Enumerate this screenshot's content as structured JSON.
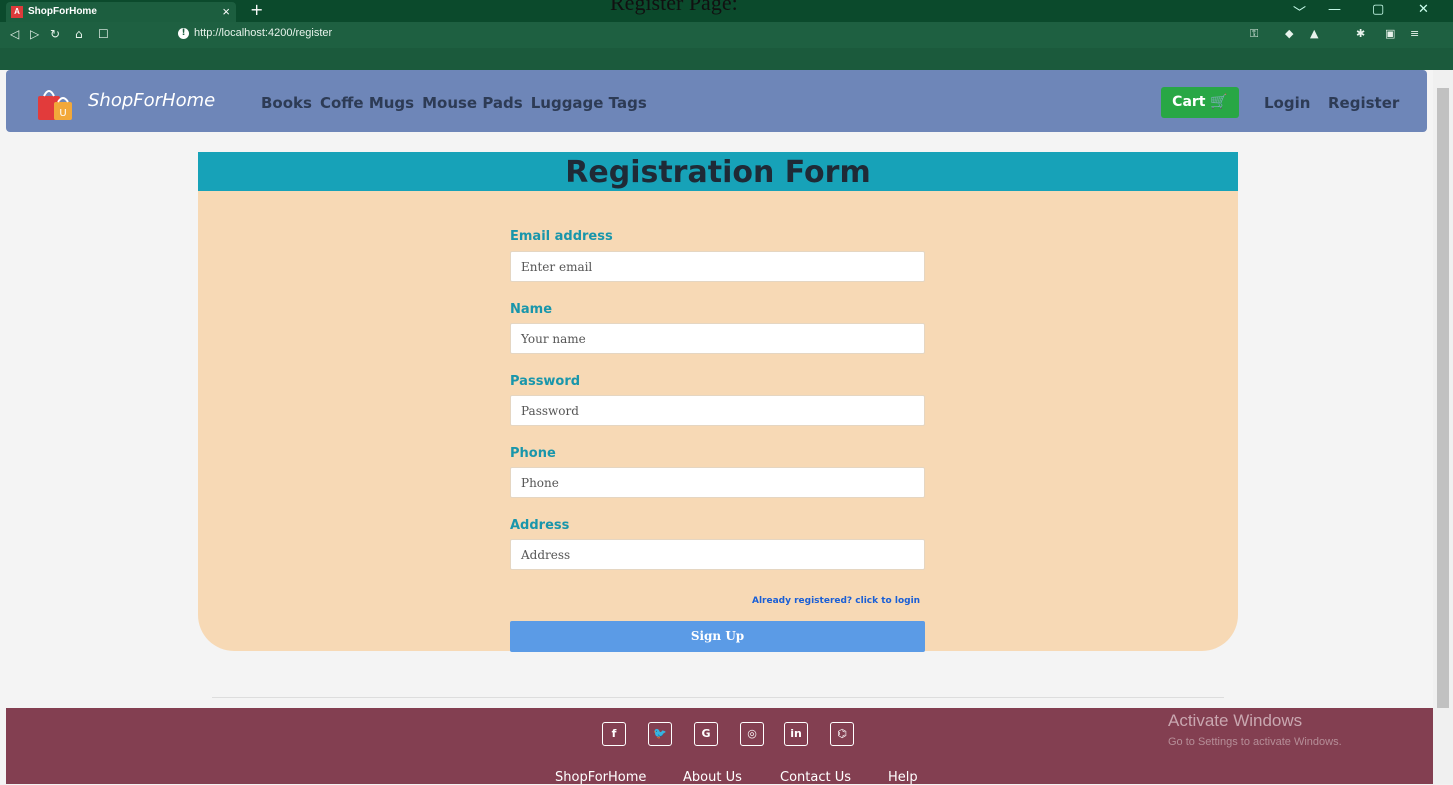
{
  "caption": "Register Page:",
  "browser": {
    "tab_title": "ShopForHome",
    "tab_close": "×",
    "new_tab": "+",
    "url": "http://localhost:4200/register",
    "window_controls": [
      "﹀",
      "—",
      "▢",
      "✕"
    ]
  },
  "nav": {
    "brand": "ShopForHome",
    "links": [
      "Books",
      "Coffe Mugs",
      "Mouse Pads",
      "Luggage Tags"
    ],
    "cart": "Cart",
    "login": "Login",
    "register": "Register"
  },
  "form": {
    "title": "Registration Form",
    "fields": [
      {
        "label": "Email address",
        "placeholder": "Enter email"
      },
      {
        "label": "Name",
        "placeholder": "Your name"
      },
      {
        "label": "Password",
        "placeholder": "Password"
      },
      {
        "label": "Phone",
        "placeholder": "Phone"
      },
      {
        "label": "Address",
        "placeholder": "Address"
      }
    ],
    "login_link": "Already registered? click to login",
    "submit": "Sign Up"
  },
  "footer": {
    "social": [
      "f",
      "🐦",
      "G",
      "◎",
      "in",
      "⌬"
    ],
    "links": [
      "ShopForHome",
      "About Us",
      "Contact Us",
      "Help"
    ]
  },
  "watermark": {
    "title": "Activate Windows",
    "subtitle": "Go to Settings to activate Windows."
  },
  "colors": {
    "navbar": "#6e86b8",
    "header": "#17a2b8",
    "card": "#f7d9b5",
    "cart": "#28a745",
    "signup": "#5b9be6",
    "footer": "#833f51"
  }
}
